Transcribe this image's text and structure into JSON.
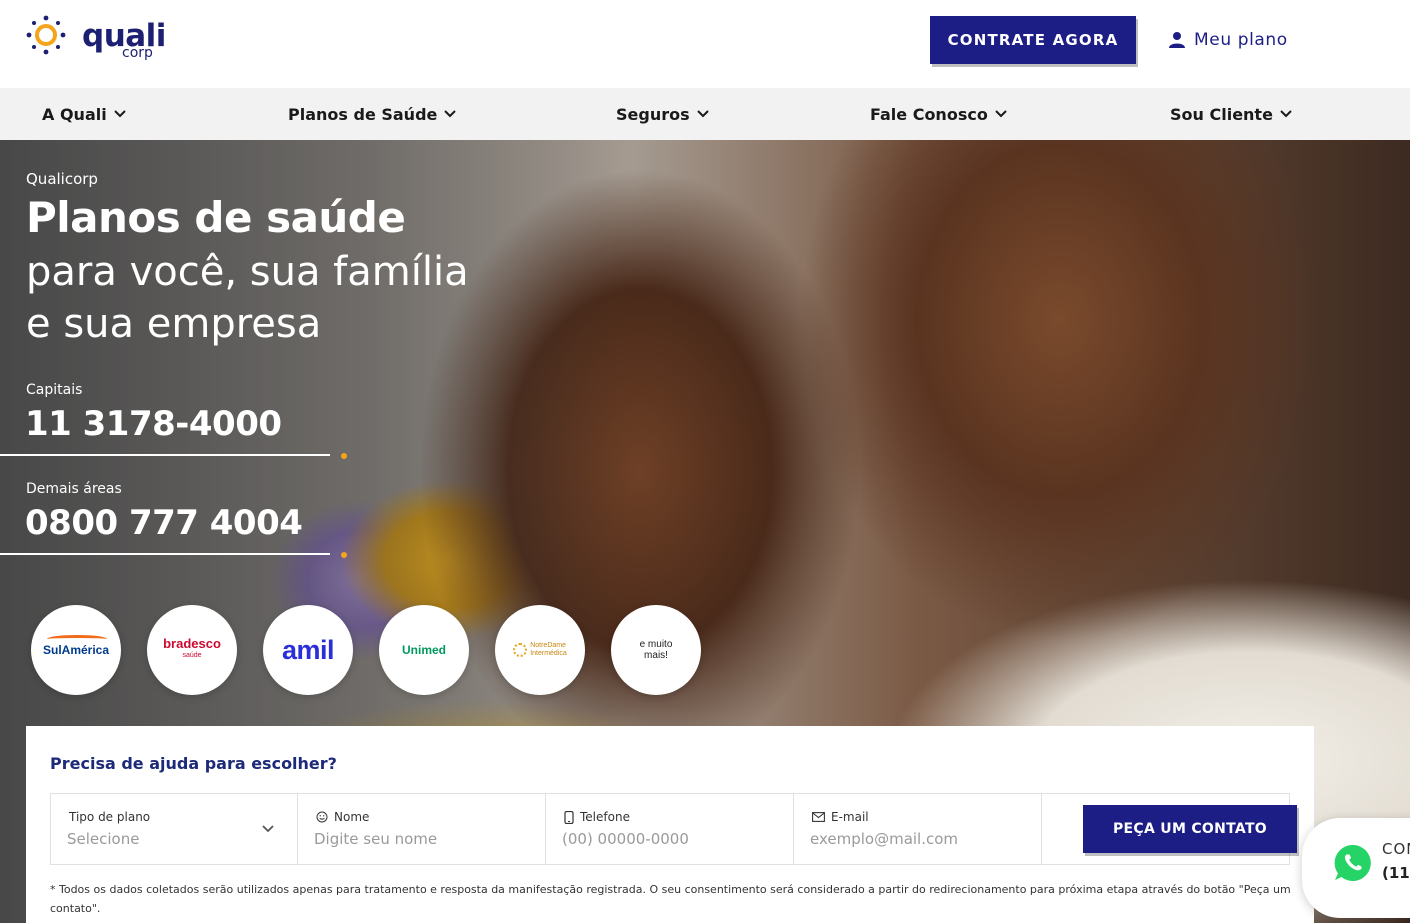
{
  "brand": {
    "logo_main": "quali",
    "logo_sub": "corp",
    "accent": "#1d1e85",
    "sun_color": "#f4a51c"
  },
  "header": {
    "cta_label": "CONTRATE AGORA",
    "account_label": "Meu plano"
  },
  "nav": {
    "items": [
      {
        "label": "A Quali"
      },
      {
        "label": "Planos de Saúde"
      },
      {
        "label": "Seguros"
      },
      {
        "label": "Fale Conosco"
      },
      {
        "label": "Sou Cliente"
      }
    ]
  },
  "hero": {
    "kicker": "Qualicorp",
    "headline_bold": "Planos de saúde",
    "headline_line2": "para você, sua família",
    "headline_line3": "e sua empresa",
    "phones": [
      {
        "label": "Capitais",
        "number": "11 3178-4000"
      },
      {
        "label": "Demais áreas",
        "number": "0800 777 4004"
      }
    ],
    "partners": [
      {
        "name": "SulAmérica"
      },
      {
        "name": "bradesco",
        "sub": "saúde"
      },
      {
        "name": "amil"
      },
      {
        "name": "Unimed"
      },
      {
        "name": "NotreDame",
        "sub": "Intermédica"
      },
      {
        "name": "e muito mais!"
      }
    ]
  },
  "form": {
    "title": "Precisa de ajuda para escolher?",
    "fields": {
      "plan_type": {
        "label": "Tipo de plano",
        "value": "Selecione"
      },
      "name": {
        "label": "Nome",
        "placeholder": "Digite seu nome"
      },
      "phone": {
        "label": "Telefone",
        "placeholder": "(00) 00000-0000"
      },
      "email": {
        "label": "E-mail",
        "placeholder": "exemplo@mail.com"
      }
    },
    "submit_label": "PEÇA UM CONTATO",
    "disclaimer": "* Todos os dados coletados serão utilizados apenas para tratamento e resposta da manifestação registrada. O seu consentimento será considerado a partir do redirecionamento para próxima etapa através do botão \"Peça um contato\"."
  },
  "whatsapp": {
    "line1": "CON",
    "line2": "(11)"
  }
}
